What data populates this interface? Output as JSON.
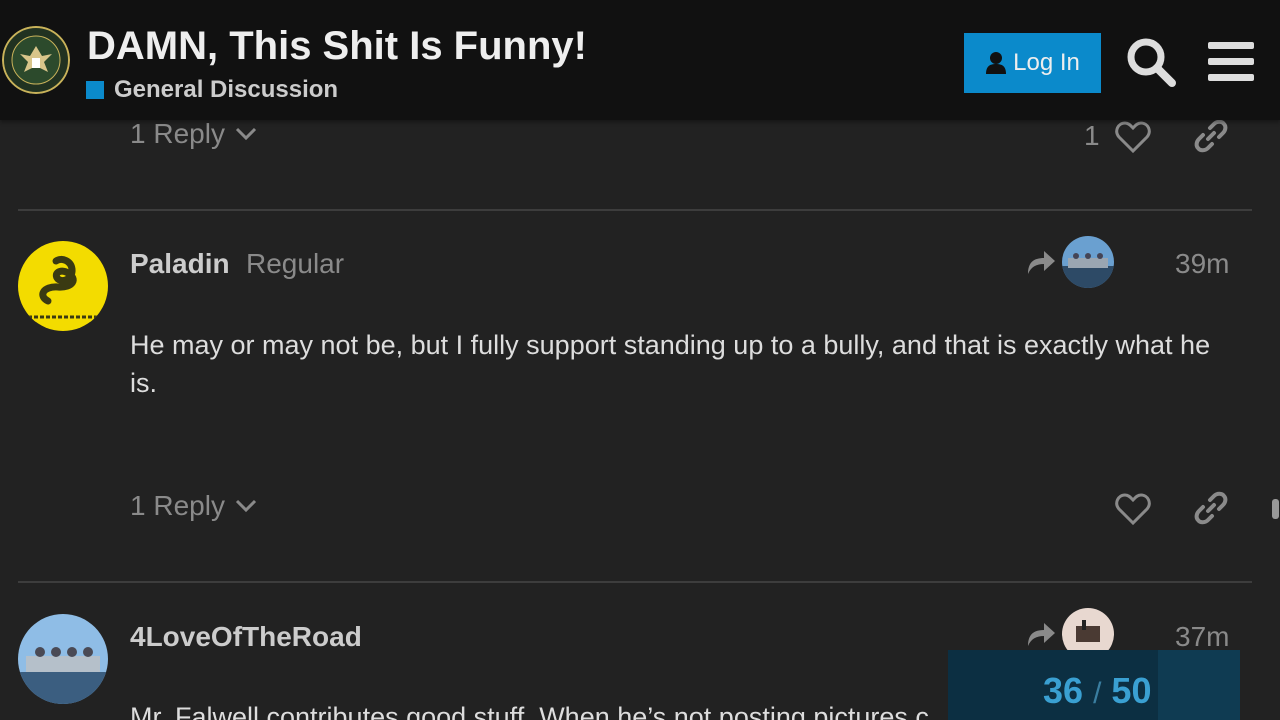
{
  "header": {
    "title": "DAMN, This Shit Is Funny!",
    "category": "General Discussion",
    "category_color": "#0b8acb",
    "login_label": "Log In",
    "logo_text": "INFOWARS ARMY",
    "icons": [
      "user-icon",
      "search-icon",
      "hamburger-menu-icon"
    ]
  },
  "previous_post": {
    "reply_label": "1 Reply",
    "like_count": "1"
  },
  "posts": [
    {
      "username": "Paladin",
      "user_title": "Regular",
      "time": "39m",
      "avatar_text": "DONT TREAD ON ME",
      "body": "He may or may not be, but I fully support standing up to a bully, and that is exactly what he is.",
      "reply_label": "1 Reply"
    },
    {
      "username": "4LoveOfTheRoad",
      "user_title": "",
      "time": "37m",
      "body": "Mr. Falwell contributes good stuff. When he’s not posting pictures c"
    }
  ],
  "progress": {
    "current": "36",
    "separator": "/",
    "total": "50",
    "fraction": 0.72
  }
}
